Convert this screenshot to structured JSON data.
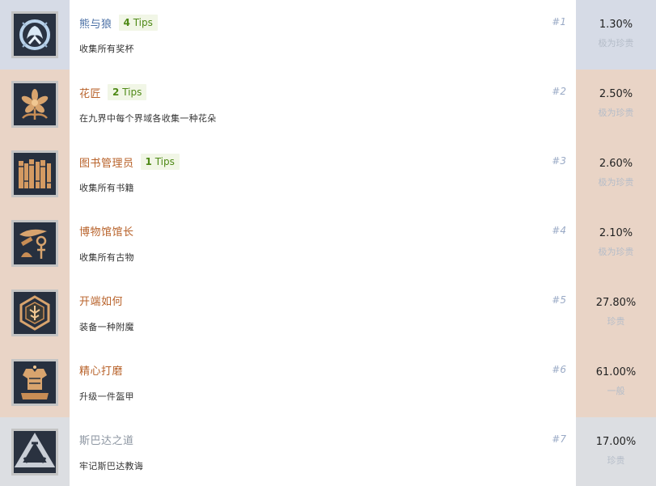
{
  "achievements": [
    {
      "rank": "#1",
      "title": "熊与狼",
      "tips_count": "4",
      "tips_label": "Tips",
      "description": "收集所有奖杯",
      "percent": "1.30%",
      "rarity": "极为珍贵",
      "icon": "platinum-bear-wolf-icon"
    },
    {
      "rank": "#2",
      "title": "花匠",
      "tips_count": "2",
      "tips_label": "Tips",
      "description": "在九界中每个界域各收集一种花朵",
      "percent": "2.50%",
      "rarity": "极为珍贵",
      "icon": "flower-icon"
    },
    {
      "rank": "#3",
      "title": "图书管理员",
      "tips_count": "1",
      "tips_label": "Tips",
      "description": "收集所有书籍",
      "percent": "2.60%",
      "rarity": "极为珍贵",
      "icon": "books-icon"
    },
    {
      "rank": "#4",
      "title": "博物馆馆长",
      "description": "收集所有古物",
      "percent": "2.10%",
      "rarity": "极为珍贵",
      "icon": "artifacts-icon"
    },
    {
      "rank": "#5",
      "title": "开端如何",
      "description": "装备一种附魔",
      "percent": "27.80%",
      "rarity": "珍贵",
      "icon": "enchantment-icon"
    },
    {
      "rank": "#6",
      "title": "精心打磨",
      "description": "升级一件盔甲",
      "percent": "61.00%",
      "rarity": "一般",
      "icon": "armor-icon"
    },
    {
      "rank": "#7",
      "title": "斯巴达之道",
      "description": "牢记斯巴达教诲",
      "percent": "17.00%",
      "rarity": "珍贵",
      "icon": "spartan-triangle-icon"
    }
  ],
  "colors": {
    "platinum_bg": "#d6dbe6",
    "gold_bg": "#e9d4c6",
    "silver_bg": "#dcdee2",
    "title_blue": "#4a6fa5",
    "title_orange": "#b8622a",
    "title_gray": "#8d96a2",
    "tips_green": "#4f8a17",
    "rank_color": "#9aaac6"
  }
}
